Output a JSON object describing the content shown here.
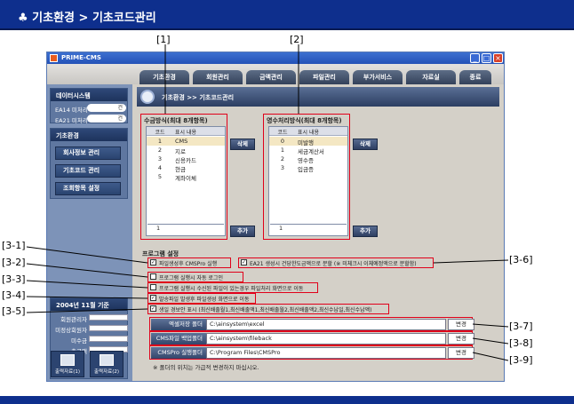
{
  "doc": {
    "title": "♣ 기초환경 > 기초코드관리"
  },
  "callouts": {
    "c1": "[1]",
    "c2": "[2]",
    "c3_1": "[3-1]",
    "c3_2": "[3-2]",
    "c3_3": "[3-3]",
    "c3_4": "[3-4]",
    "c3_5": "[3-5]",
    "c3_6": "[3-6]",
    "c3_7": "[3-7]",
    "c3_8": "[3-8]",
    "c3_9": "[3-9]"
  },
  "window": {
    "title": "PRIME-CMS",
    "min": "_",
    "max": "□",
    "close": "×"
  },
  "tabs": [
    "기초환경",
    "회원관리",
    "금액관리",
    "파일관리",
    "부가서비스",
    "자료실",
    "종료"
  ],
  "sidebar": {
    "monitor": {
      "title": "데이터시스템",
      "rows": [
        {
          "label": "EA14 미처리",
          "value": "건"
        },
        {
          "label": "EA21 미처리",
          "value": "건"
        }
      ]
    },
    "basic": {
      "title": "기초환경",
      "items": [
        "회사정보 관리",
        "기초코드 관리",
        "조회항목 설정"
      ]
    },
    "stats": {
      "title": "2004년 11월 기준",
      "rows": [
        "회원관리자",
        "미정상회원자",
        "미수금",
        "출금액"
      ]
    },
    "print_buttons": [
      "출력자료(1)",
      "출력자료(2)"
    ]
  },
  "content": {
    "breadcrumb": "기초환경 >> 기초코드관리",
    "pay_list": {
      "title": "수금방식(최대 8개항목)",
      "head_code": "코드",
      "head_name": "표시 내용",
      "rows": [
        {
          "code": "1",
          "name": "CMS"
        },
        {
          "code": "2",
          "name": "지로"
        },
        {
          "code": "3",
          "name": "신용카드"
        },
        {
          "code": "4",
          "name": "현금"
        },
        {
          "code": "5",
          "name": "계좌이체"
        }
      ],
      "input_code": "1",
      "delete_label": "삭제",
      "add_label": "추가"
    },
    "receipt_list": {
      "title": "영수처리방식(최대 8개항목)",
      "head_code": "코드",
      "head_name": "표시 내용",
      "rows": [
        {
          "code": "0",
          "name": "미발행"
        },
        {
          "code": "1",
          "name": "세금계산서"
        },
        {
          "code": "2",
          "name": "영수증"
        },
        {
          "code": "3",
          "name": "입금증"
        }
      ],
      "input_code": "1",
      "delete_label": "삭제",
      "add_label": "추가"
    },
    "program": {
      "title": "프로그램 설정",
      "options": [
        "파일생성후 CMSPro 실행",
        "프로그램 실행시 자동 로그인",
        "프로그램 실행시 수신된 파일이 있는경우 파일처리 화면으로 이동",
        "발송파일 발생후 파일생성 화면으로 이동",
        "생일 경보안 표시 (최신배출월1,최신배출액1,최신배출월2,최신배출액2,최신수납일,최신수납액)"
      ],
      "ea21_option": "EA21 생성시 건당한도금액으로 분할 (※ 미체크시 이체예정액으로 분할함)"
    },
    "folders": [
      {
        "label": "엑셀저장 폴더",
        "path": "C:\\ainsystem\\excel",
        "button": "변경"
      },
      {
        "label": "CMS파일 백업폴더",
        "path": "C:\\ainsystem\\fileback",
        "button": "변경"
      },
      {
        "label": "CMSPro 실행폴더",
        "path": "C:\\Program Files\\CMSPro",
        "button": "변경"
      }
    ],
    "folder_note": "※ 폴더의 위치는 가급적 변경하지 마십시오."
  },
  "colors": {
    "doc_bar": "#0e2f8d",
    "highlight": "#e0001a",
    "selected_row": "#f4e7c3"
  }
}
